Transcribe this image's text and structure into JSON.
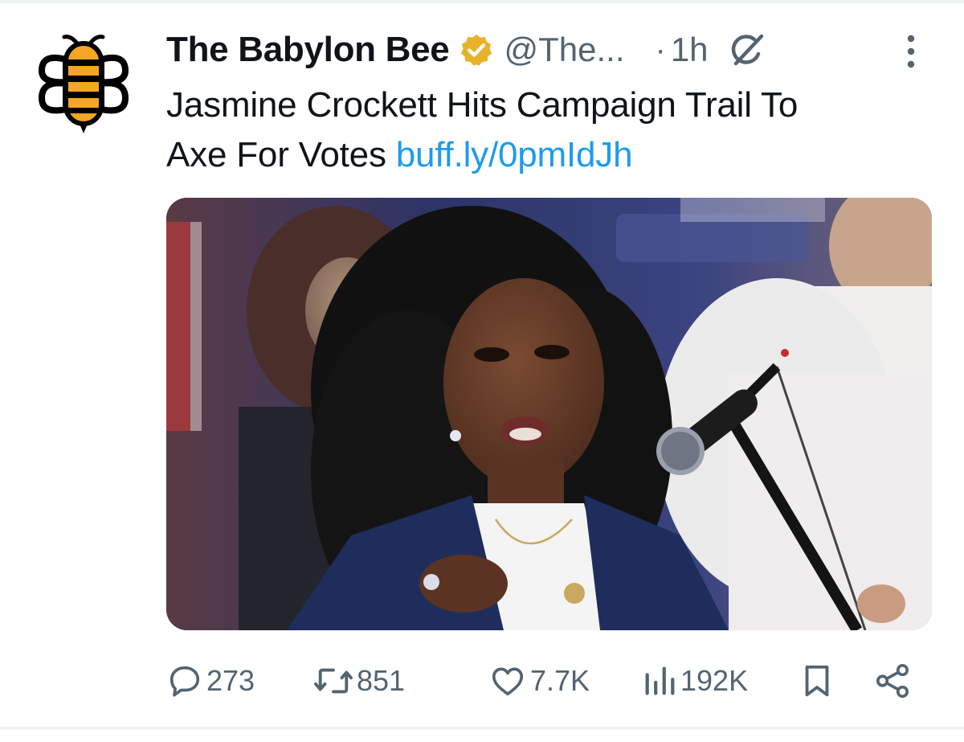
{
  "tweet": {
    "author": {
      "display_name": "The Babylon Bee",
      "handle": "@The...",
      "avatar_icon": "bee-logo-icon",
      "verified_icon": "verified-badge-icon"
    },
    "timestamp_separator": "·",
    "timestamp": "1h",
    "text_line_1": "Jasmine Crockett Hits Campaign Trail To",
    "text_line_2_prefix": "Axe For Votes ",
    "link": "buff.ly/0pmIdJh"
  },
  "actions": {
    "replies": {
      "icon": "reply-icon",
      "count": "273"
    },
    "reposts": {
      "icon": "repost-icon",
      "count": "851"
    },
    "likes": {
      "icon": "heart-icon",
      "count": "7.7K"
    },
    "views": {
      "icon": "views-chart-icon",
      "count": "192K"
    },
    "bookmark": {
      "icon": "bookmark-icon"
    },
    "share": {
      "icon": "share-icon"
    }
  },
  "colors": {
    "text": "#0f1419",
    "secondary": "#536471",
    "link": "#1d9bf0",
    "verified_gold": "#e8b32a",
    "bee_yellow": "#f5a623"
  }
}
